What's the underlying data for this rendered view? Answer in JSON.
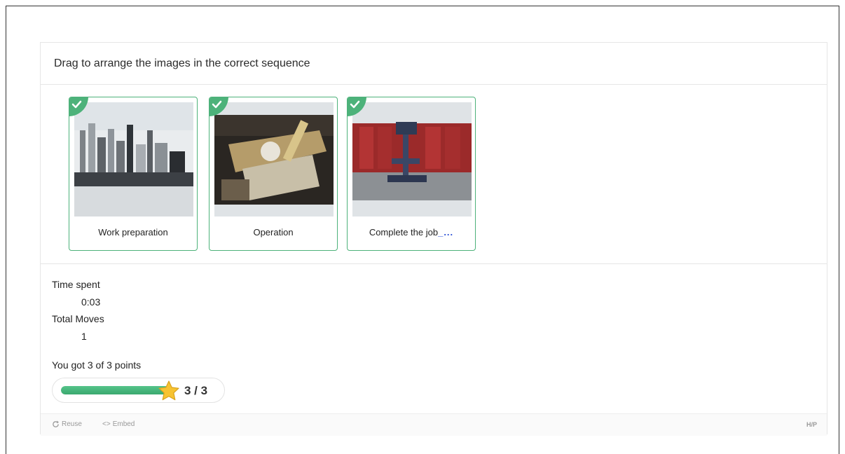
{
  "instruction": "Drag to arrange the images in the correct sequence",
  "tiles": [
    {
      "label": "Work preparation",
      "suffix": "",
      "image_icon": "cutting-tools-image",
      "status": "correct"
    },
    {
      "label": "Operation",
      "suffix": "",
      "image_icon": "lathe-operation-image",
      "status": "correct"
    },
    {
      "label": "Complete the job",
      "suffix": "_...",
      "image_icon": "workshop-drill-press-image",
      "status": "correct"
    }
  ],
  "stats": {
    "time_label": "Time spent",
    "time_value": "0:03",
    "moves_label": "Total Moves",
    "moves_value": "1"
  },
  "score": {
    "feedback": "You got 3 of 3 points",
    "text": "3 / 3",
    "achieved": 3,
    "max": 3
  },
  "footer": {
    "reuse_label": "Reuse",
    "embed_label": "Embed",
    "brand": "H/P"
  },
  "colors": {
    "correct": "#4db27a",
    "progress": "#46b67b",
    "star": "#f7c331"
  }
}
